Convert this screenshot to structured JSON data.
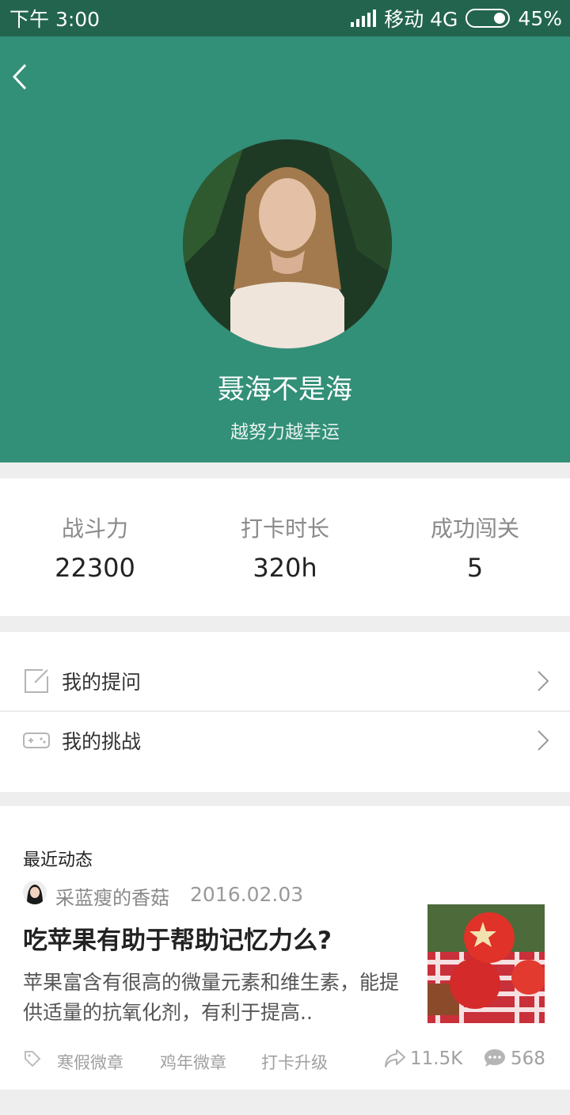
{
  "status_bar": {
    "time": "下午 3:00",
    "carrier": "移动 4G",
    "battery": "45%"
  },
  "profile": {
    "name": "聂海不是海",
    "motto": "越努力越幸运"
  },
  "stats": [
    {
      "label": "战斗力",
      "value": "22300"
    },
    {
      "label": "打卡时长",
      "value": "320h"
    },
    {
      "label": "成功闯关",
      "value": "5"
    }
  ],
  "menu": {
    "items": [
      {
        "label": "我的提问",
        "icon": "edit-icon"
      },
      {
        "label": "我的挑战",
        "icon": "gamepad-icon"
      }
    ]
  },
  "feed": {
    "title": "最近动态",
    "post": {
      "author": "采蓝瘦的香菇",
      "date": "2016.02.03",
      "title": "吃苹果有助于帮助记忆力么?",
      "excerpt": "苹果富含有很高的微量元素和维生素，能提供适量的抗氧化剂，有利于提高..",
      "tags": [
        "寒假微章",
        "鸡年微章",
        "打卡升级"
      ],
      "shares": "11.5K",
      "comments": "568"
    }
  },
  "colors": {
    "status_bar": "#23644f",
    "header": "#328f78"
  }
}
